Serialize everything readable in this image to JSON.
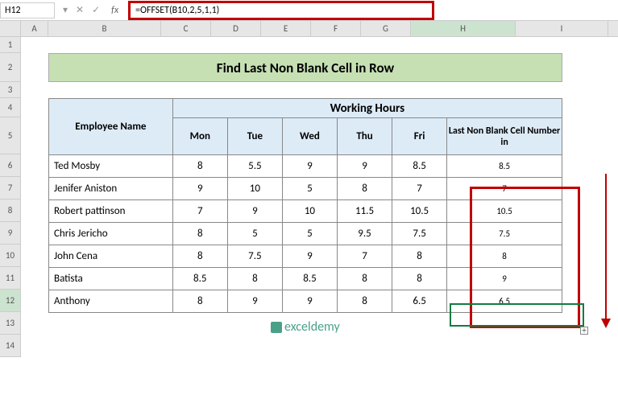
{
  "name_box": "H12",
  "formula": "=OFFSET(B10,2,5,1,1)",
  "columns": [
    "A",
    "B",
    "C",
    "D",
    "E",
    "F",
    "G",
    "H",
    "I"
  ],
  "rows": [
    "1",
    "2",
    "3",
    "4",
    "5",
    "6",
    "7",
    "8",
    "9",
    "10",
    "11",
    "12",
    "13",
    "14"
  ],
  "title": "Find Last Non Blank Cell in Row",
  "headers": {
    "employee": "Employee Name",
    "working_hours": "Working Hours",
    "days": [
      "Mon",
      "Tue",
      "Wed",
      "Thu",
      "Fri"
    ],
    "last_col": "Last Non Blank Cell Number in"
  },
  "data_rows": [
    {
      "name": "Ted Mosby",
      "vals": [
        "8",
        "5.5",
        "9",
        "9",
        "8.5"
      ],
      "last": "8.5"
    },
    {
      "name": "Jenifer Aniston",
      "vals": [
        "9",
        "10",
        "5",
        "8",
        "7"
      ],
      "last": "7"
    },
    {
      "name": "Robert pattinson",
      "vals": [
        "7",
        "9",
        "10",
        "11.5",
        "10.5"
      ],
      "last": "10.5"
    },
    {
      "name": "Chris Jericho",
      "vals": [
        "8",
        "5",
        "5",
        "9.5",
        "7.5"
      ],
      "last": "7.5"
    },
    {
      "name": "John Cena",
      "vals": [
        "8",
        "7.5",
        "9",
        "7",
        "8"
      ],
      "last": "8"
    },
    {
      "name": "Batista",
      "vals": [
        "8.5",
        "8",
        "8.5",
        "8",
        "8"
      ],
      "last": "9"
    },
    {
      "name": "Anthony",
      "vals": [
        "8",
        "9",
        "9",
        "8",
        "6.5"
      ],
      "last": "6.5"
    }
  ],
  "watermark": "exceldemy",
  "chart_data": {
    "type": "table",
    "title": "Find Last Non Blank Cell in Row",
    "columns": [
      "Employee Name",
      "Mon",
      "Tue",
      "Wed",
      "Thu",
      "Fri",
      "Last Non Blank Cell Number in"
    ],
    "rows": [
      [
        "Ted Mosby",
        8,
        5.5,
        9,
        9,
        8.5,
        8.5
      ],
      [
        "Jenifer Aniston",
        9,
        10,
        5,
        8,
        7,
        7
      ],
      [
        "Robert pattinson",
        7,
        9,
        10,
        11.5,
        10.5,
        10.5
      ],
      [
        "Chris Jericho",
        8,
        5,
        5,
        9.5,
        7.5,
        7.5
      ],
      [
        "John Cena",
        8,
        7.5,
        9,
        7,
        8,
        8
      ],
      [
        "Batista",
        8.5,
        8,
        8.5,
        8,
        8,
        9
      ],
      [
        "Anthony",
        8,
        9,
        9,
        8,
        6.5,
        6.5
      ]
    ]
  }
}
